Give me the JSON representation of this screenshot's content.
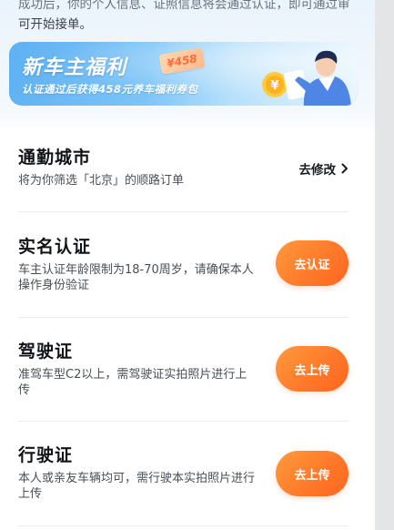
{
  "intro": {
    "line1": "成功后，你的个人信息、证照信息将会通过认证，即可通过审",
    "line2": "可开始接单。"
  },
  "banner": {
    "title": "新车主福利",
    "coupon": "¥458",
    "subtitle": "认证通过后获得458元养车福利券包"
  },
  "city": {
    "title": "通勤城市",
    "desc": "将为你筛选「北京」的顺路订单",
    "action": "去修改",
    "action_icon": "chevron-right-icon"
  },
  "realname": {
    "title": "实名认证",
    "desc": "车主认证年龄限制为18-70周岁，请确保本人操作身份验证",
    "action": "去认证"
  },
  "driver_license": {
    "title": "驾驶证",
    "desc": "准驾车型C2以上，需驾驶证实拍照片进行上传",
    "action": "去上传"
  },
  "vehicle_license": {
    "title": "行驶证",
    "desc": "本人或亲友车辆均可，需行驶本实拍照片进行上传",
    "action": "去上传"
  },
  "colors": {
    "accent": "#ff7a2a",
    "banner": "#6fbaf5"
  }
}
